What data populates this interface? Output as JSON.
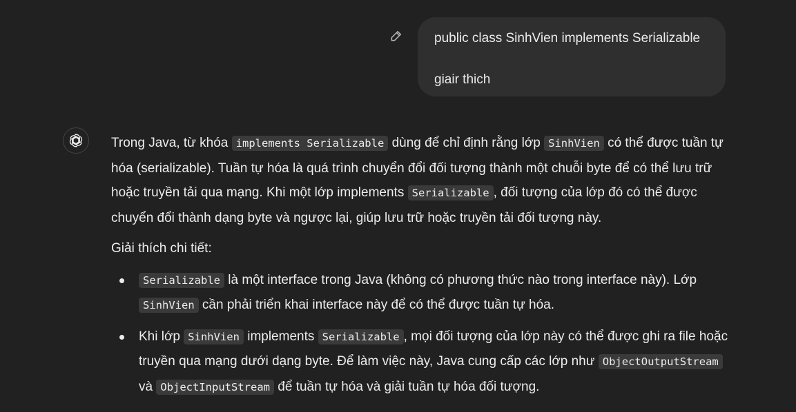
{
  "user_message": {
    "line1": "public class SinhVien implements Serializable",
    "line2": "giair thich"
  },
  "icons": {
    "edit": "pencil-icon",
    "assistant": "openai-logo-icon"
  },
  "answer": {
    "p1": {
      "t1": "Trong Java, từ khóa ",
      "c1": "implements Serializable",
      "t2": " dùng để chỉ định rằng lớp ",
      "c2": "SinhVien",
      "t3": " có thể được tuần tự hóa (serializable). Tuần tự hóa là quá trình chuyển đổi đối tượng thành một chuỗi byte để có thể lưu trữ hoặc truyền tải qua mạng. Khi một lớp implements ",
      "c3": "Serializable",
      "t4": ", đối tượng của lớp đó có thể được chuyển đổi thành dạng byte và ngược lại, giúp lưu trữ hoặc truyền tải đối tượng này."
    },
    "p2": "Giải thích chi tiết:",
    "bullet1": {
      "c1": "Serializable",
      "t1": " là một interface trong Java (không có phương thức nào trong interface này). Lớp ",
      "c2": "SinhVien",
      "t2": " cần phải triển khai interface này để có thể được tuần tự hóa."
    },
    "bullet2": {
      "t1": "Khi lớp ",
      "c1": "SinhVien",
      "t2": " implements ",
      "c2": "Serializable",
      "t3": ", mọi đối tượng của lớp này có thể được ghi ra file hoặc truyền qua mạng dưới dạng byte. Để làm việc này, Java cung cấp các lớp như ",
      "c3": "ObjectOutputStream",
      "t4": " và ",
      "c4": "ObjectInputStream",
      "t5": " để tuần tự hóa và giải tuần tự hóa đối tượng."
    }
  }
}
